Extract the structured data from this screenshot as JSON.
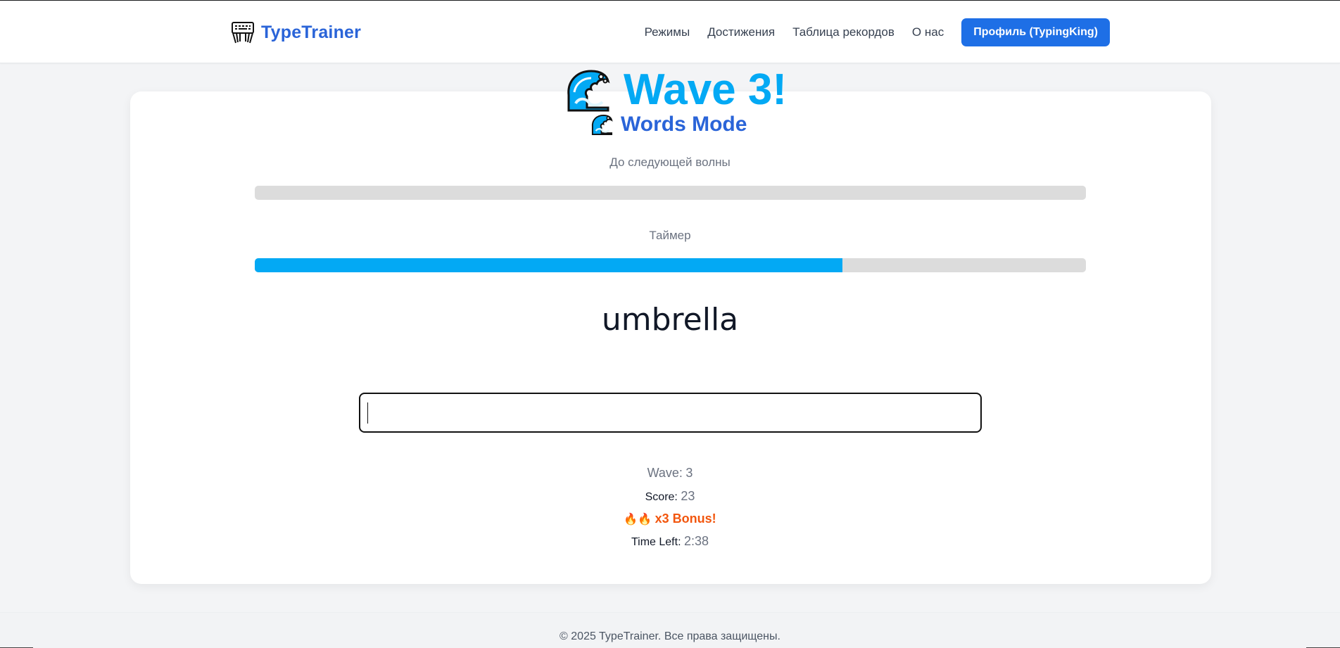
{
  "header": {
    "brand": "TypeTrainer",
    "brand_icon": "keyboard-hands-icon",
    "nav": {
      "modes": "Режимы",
      "achievements": "Достижения",
      "leaderboard": "Таблица рекордов",
      "about": "О нас",
      "profile": "Профиль (TypingKing)"
    }
  },
  "game": {
    "wave_title": "Wave 3!",
    "mode_title": "Words Mode",
    "wave_icon": "water-wave-icon",
    "next_wave_label": "До следующей волны",
    "next_wave_progress": 0,
    "timer_label": "Таймер",
    "timer_progress": 0.707,
    "accent_color": "#03a9f4",
    "current_word": "umbrella",
    "input_value": ""
  },
  "stats": {
    "wave_label": "Wave:",
    "wave_value": "3",
    "score_label": "Score:",
    "score_value": "23",
    "bonus_icons": "🔥🔥",
    "bonus_text": "x3 Bonus!",
    "time_label": "Time Left:",
    "time_value": "2:38"
  },
  "footer": {
    "copyright": "© 2025 TypeTrainer. Все права защищены."
  }
}
